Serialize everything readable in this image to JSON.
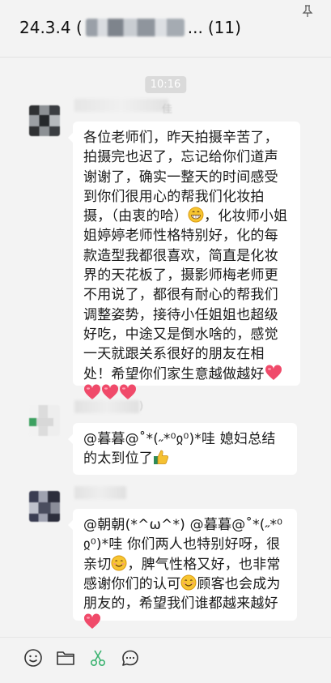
{
  "header": {
    "title_prefix": "24.3.4  (",
    "title_suffix": "...",
    "member_count": "(11)",
    "pin_icon": "pin-icon"
  },
  "messages": {
    "timestamp": "10:16",
    "first": {
      "name_tail": "佳",
      "text_a": "各位老师们，昨天拍摄辛苦了，拍摄完也迟了，忘记给你们道声谢谢了，确实一整天的时间感受到你们很用心的帮我们化妆拍摄，（由衷的哈）",
      "text_b": "，化妆师小姐姐婷婷老师性格特别好，化的每款造型我都很喜欢，简直是化妆界的天花板了，摄影师梅老师更不用说了，都很有耐心的帮我们调整姿势，接待小任姐姐也超级好吃，中途又是倒水啥的，感觉一天就跟关系很好的朋友在相处！希望你们家生意越做越好",
      "emoji_grin": "grinning-face-icon",
      "emoji_hearts": "red-heart-icon"
    },
    "second": {
      "name_tail": ")",
      "text": "@暮暮@˚*(˶*⁰ჲ⁰)*哇 媳妇总结的太到位了",
      "emoji": "thumbs-up-icon"
    },
    "third": {
      "text_a": "@朝朝(*^ω^*) @暮暮@˚*(˶*⁰ჲ⁰)*哇 你们两人也特别好呀，很亲切",
      "text_b": "，脾气性格又好，也非常感谢你们的认可",
      "text_c": "顾客也会成为朋友的，希望我们谁都越来越好",
      "emoji_smile": "smiling-face-icon",
      "emoji_heart": "red-heart-icon"
    }
  },
  "toolbar": {
    "items": [
      "emoji-icon",
      "folder-icon",
      "scissors-icon",
      "chat-bubble-icon"
    ],
    "accent": "#3cb371"
  }
}
